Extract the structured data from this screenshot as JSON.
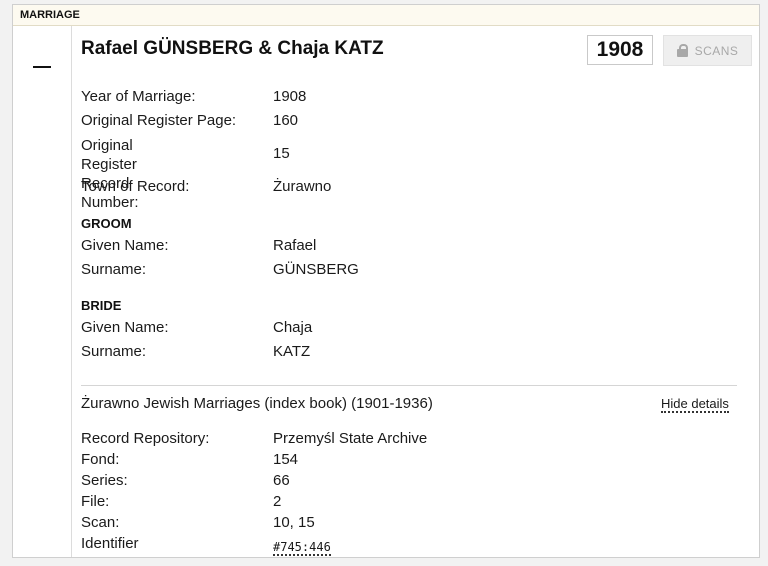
{
  "card": {
    "header_label": "MARRIAGE"
  },
  "record": {
    "title": "Rafael GÜNSBERG & Chaja KATZ",
    "year_badge": "1908",
    "scans_label": "SCANS"
  },
  "details": [
    {
      "label": "Year of Marriage:",
      "value": "1908"
    },
    {
      "label": "Original Register Page:",
      "value": "160"
    },
    {
      "label": "Original Register Record\nNumber:",
      "value": "15"
    },
    {
      "label": "Town of Record:",
      "value": "Żurawno"
    }
  ],
  "groom": {
    "heading": "GROOM",
    "fields": [
      {
        "label": "Given Name:",
        "value": "Rafael"
      },
      {
        "label": "Surname:",
        "value": "GÜNSBERG"
      }
    ]
  },
  "bride": {
    "heading": "BRIDE",
    "fields": [
      {
        "label": "Given Name:",
        "value": "Chaja"
      },
      {
        "label": "Surname:",
        "value": "KATZ"
      }
    ]
  },
  "source": {
    "collection_title": "Żurawno Jewish Marriages (index book) (1901-1936)",
    "hide_details_label": "Hide details",
    "fields": [
      {
        "label": "Record Repository:",
        "value": "Przemyśl State Archive"
      },
      {
        "label": "Fond:",
        "value": "154"
      },
      {
        "label": "Series:",
        "value": "66"
      },
      {
        "label": "File:",
        "value": "2"
      },
      {
        "label": "Scan:",
        "value": "10, 15"
      },
      {
        "label": "Identifier",
        "value": "#745:446"
      }
    ]
  },
  "icons": {
    "collapse": "minus-icon",
    "scans": "lock-icon"
  },
  "colors": {
    "header_bg": "#fdfaf0",
    "disabled_button": "#efefef",
    "disabled_text": "#a8a8a8"
  }
}
